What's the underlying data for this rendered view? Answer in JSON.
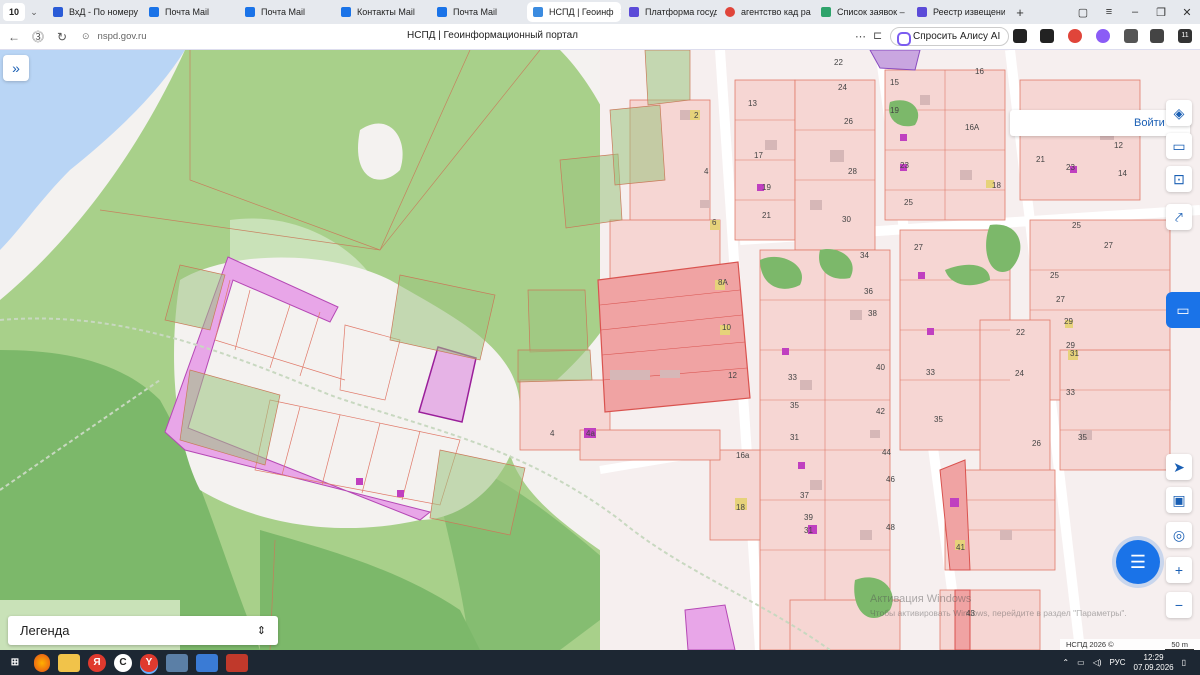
{
  "browser": {
    "tab_count": "10",
    "tabs": [
      {
        "label": "ВхД - По номеру",
        "color": "#2a5bd7"
      },
      {
        "label": "Почта Mail",
        "color": "#1a73e8"
      },
      {
        "label": "Почта Mail",
        "color": "#1a73e8"
      },
      {
        "label": "Контакты Mail",
        "color": "#1a73e8"
      },
      {
        "label": "Почта Mail",
        "color": "#1a73e8"
      },
      {
        "label": "НСПД | Геоинф",
        "color": "#3b8be0"
      },
      {
        "label": "Платформа госуд",
        "color": "#5b4bd8"
      },
      {
        "label": "агентство кад ра",
        "color": "#e0453a"
      },
      {
        "label": "Список заявок –",
        "color": "#2ea36b"
      },
      {
        "label": "Реестр извещени",
        "color": "#5b4bd8"
      }
    ],
    "new_tab": "+",
    "url": "nspd.gov.ru",
    "page_title": "НСПД | Геоинформационный портал",
    "alice_button": "Спросить Алису AI",
    "ext_badge": "11"
  },
  "map": {
    "login_label": "Войти",
    "expand_icon": "»",
    "zoom_in": "+",
    "zoom_out": "−",
    "legend_label": "Легенда",
    "attribution": "НСПД 2026 ©",
    "scale": "50 m",
    "watermark_title": "Активация Windows",
    "watermark_text": "Чтобы активировать Windows, перейдите в раздел \"Параметры\".",
    "parcel_labels": [
      "2",
      "4",
      "6",
      "4",
      "4а",
      "8А",
      "10",
      "12",
      "16а",
      "18",
      "13",
      "17",
      "19",
      "21",
      "22",
      "24",
      "26",
      "28",
      "30",
      "15",
      "16",
      "16А",
      "18",
      "19",
      "23",
      "25",
      "27",
      "21",
      "25",
      "12",
      "14",
      "15",
      "23",
      "25",
      "34",
      "36",
      "38",
      "27",
      "25",
      "27",
      "29",
      "22",
      "24",
      "26",
      "29",
      "31",
      "33",
      "35",
      "40",
      "42",
      "44",
      "46",
      "48",
      "33",
      "35",
      "37",
      "39",
      "31",
      "33",
      "35",
      "31",
      "41",
      "43"
    ]
  },
  "colors": {
    "water": "#b9d5f5",
    "forest_dark": "#7cb86a",
    "forest_light": "#a8d08a",
    "forest_pale": "#c9e2b8",
    "parcel_pink": "#f6d6d3",
    "parcel_line": "#e07a6a",
    "parcel_red": "#f0a3a3",
    "magenta": "#e8a6e8",
    "building": "#d6b7b7",
    "road": "#ffffff"
  },
  "taskbar": {
    "lang": "РУС",
    "time": "12:29",
    "date": "07.09.2026",
    "icons": [
      "⊞",
      "Firefox",
      "Explorer",
      "Я",
      "C",
      "Y",
      "Photos",
      "Files",
      "Calendar"
    ]
  }
}
